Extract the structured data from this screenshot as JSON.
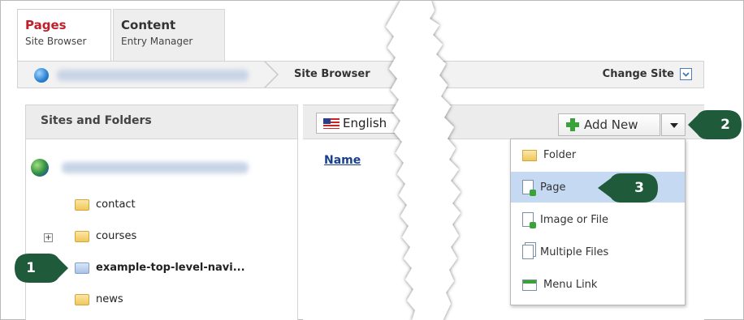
{
  "tabs": [
    {
      "title": "Pages",
      "subtitle": "Site Browser"
    },
    {
      "title": "Content",
      "subtitle": "Entry Manager"
    }
  ],
  "breadcrumb": {
    "current": "Site Browser",
    "change_site_label": "Change Site"
  },
  "left_panel": {
    "title": "Sites and Folders",
    "items": [
      {
        "label": "contact"
      },
      {
        "label": "courses"
      },
      {
        "label": "example-top-level-navi..."
      },
      {
        "label": "news"
      }
    ]
  },
  "right_panel": {
    "language": "English",
    "name_column": "Name",
    "add_new_label": "Add New"
  },
  "menu": {
    "items": [
      {
        "label": "Folder"
      },
      {
        "label": "Page"
      },
      {
        "label": "Image or File"
      },
      {
        "label": "Multiple Files"
      },
      {
        "label": "Menu Link"
      }
    ]
  },
  "callouts": [
    "1",
    "2",
    "3"
  ],
  "colors": {
    "callout": "#1f5a3a",
    "selected_menu": "#c5daf2",
    "active_tab_title": "#c0202a",
    "link": "#1a3f8c"
  }
}
